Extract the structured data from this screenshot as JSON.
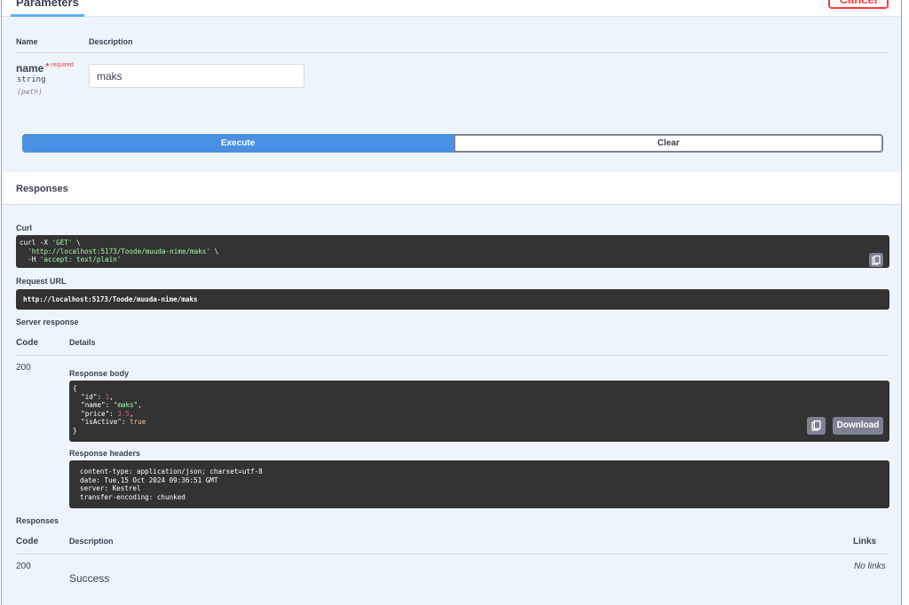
{
  "parameters": {
    "tab_label": "Parameters",
    "cancel_label": "Cancel",
    "col_name": "Name",
    "col_description": "Description",
    "param": {
      "name": "name",
      "star": "*",
      "required_label": "required",
      "type": "string",
      "location": "(path)",
      "value": "maks"
    },
    "execute_label": "Execute",
    "clear_label": "Clear"
  },
  "responses_section": {
    "title": "Responses",
    "curl_label": "Curl",
    "curl_lines": {
      "l1_prefix": "curl -X ",
      "l1_method": "'GET'",
      "l1_suffix": " \\",
      "l2_url": "'http://localhost:5173/Toode/muuda-nime/maks'",
      "l2_suffix": " \\",
      "l3_prefix": "  -H ",
      "l3_header": "'accept: text/plain'"
    },
    "request_url_label": "Request URL",
    "request_url": "http://localhost:5173/Toode/muuda-nime/maks",
    "server_response_label": "Server response",
    "col_code": "Code",
    "col_details": "Details",
    "code": "200",
    "response_body_label": "Response body",
    "body": {
      "open": "{",
      "id_key": "\"id\"",
      "id_val": "1",
      "name_key": "\"name\"",
      "name_val": "\"maks\"",
      "price_key": "\"price\"",
      "price_val": "3.5",
      "active_key": "\"isActive\"",
      "active_val": "true",
      "close": "}"
    },
    "download_label": "Download",
    "response_headers_label": "Response headers",
    "headers": [
      "content-type: application/json; charset=utf-8",
      "date: Tue,15 Oct 2024 09:36:51 GMT",
      "server: Kestrel",
      "transfer-encoding: chunked"
    ]
  },
  "documented_responses": {
    "title": "Responses",
    "col_code": "Code",
    "col_description": "Description",
    "col_links": "Links",
    "code": "200",
    "description": "Success",
    "links": "No links"
  },
  "icons": {
    "copy": "clipboard-copy-icon"
  }
}
